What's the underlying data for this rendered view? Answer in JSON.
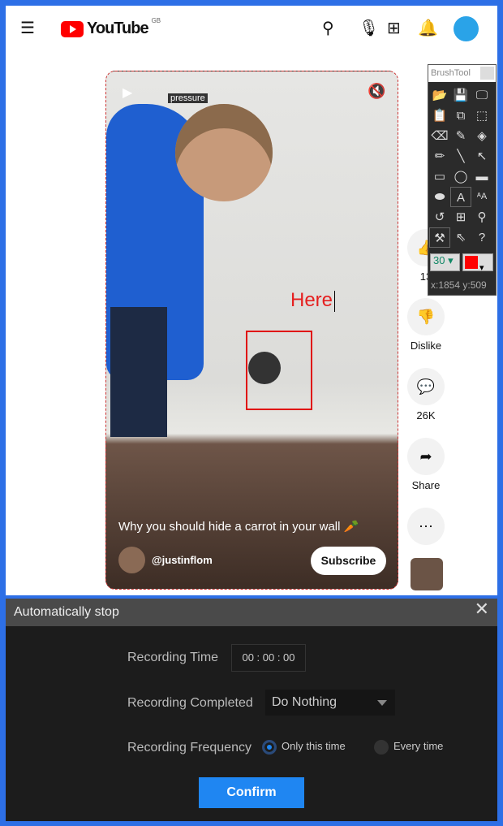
{
  "header": {
    "brand": "YouTube",
    "region": "GB",
    "icons": [
      "menu-icon",
      "search-icon",
      "mic-icon",
      "create-icon",
      "bell-icon",
      "avatar"
    ]
  },
  "video": {
    "tag": "pressure",
    "annotation": "Here",
    "caption": "Why you should hide a carrot in your wall 🥕",
    "channel": "@justinflom",
    "subscribe": "Subscribe"
  },
  "actions": {
    "likes": "13",
    "dislike": "Dislike",
    "comments": "26K",
    "share": "Share"
  },
  "brushtool": {
    "title": "BrushTool",
    "size": "30",
    "color": "#ff0000",
    "coords": "x:1854 y:509"
  },
  "dialog": {
    "title": "Automatically stop",
    "recording_time_label": "Recording Time",
    "recording_time": "00 : 00 : 00",
    "completed_label": "Recording Completed",
    "completed_value": "Do Nothing",
    "frequency_label": "Recording Frequency",
    "option1": "Only this time",
    "option2": "Every time",
    "selected": "Only this time",
    "confirm": "Confirm"
  }
}
